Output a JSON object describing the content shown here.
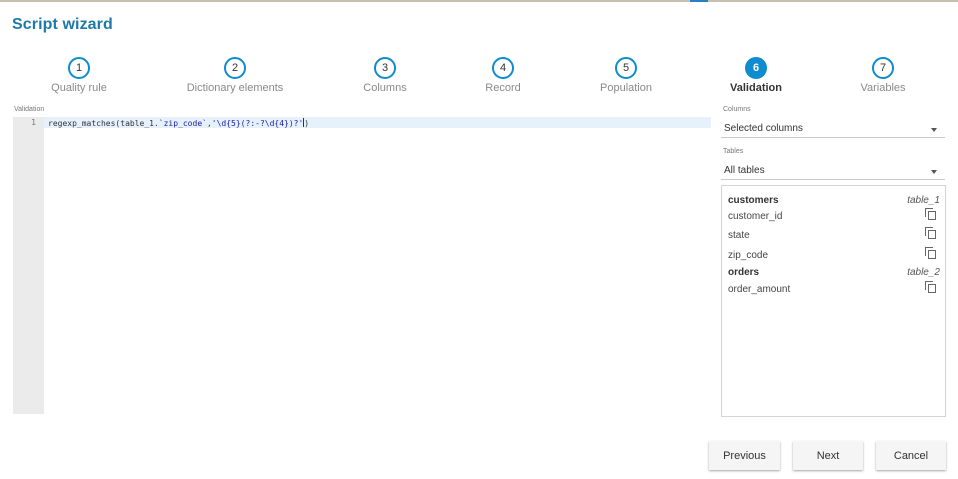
{
  "dialog": {
    "title": "Script wizard"
  },
  "steps": [
    {
      "number": "1",
      "label": "Quality rule"
    },
    {
      "number": "2",
      "label": "Dictionary elements"
    },
    {
      "number": "3",
      "label": "Columns"
    },
    {
      "number": "4",
      "label": "Record"
    },
    {
      "number": "5",
      "label": "Population"
    },
    {
      "number": "6",
      "label": "Validation",
      "active": true
    },
    {
      "number": "7",
      "label": "Variables"
    }
  ],
  "editor": {
    "caption": "Validation",
    "lines": [
      {
        "number": "1",
        "prefix": "regexp_matches(table_1.",
        "str1": "`zip_code`",
        "sep": ",",
        "str2": "'\\d{5}(?:-?\\d{4})?'",
        "suffix": ")"
      }
    ]
  },
  "columns_select": {
    "caption": "Columns",
    "value": "Selected columns"
  },
  "tables_select": {
    "caption": "Tables",
    "value": "All tables"
  },
  "tables": [
    {
      "name": "customers",
      "alias": "table_1",
      "columns": [
        "customer_id",
        "state",
        "zip_code"
      ]
    },
    {
      "name": "orders",
      "alias": "table_2",
      "columns": [
        "order_amount"
      ]
    }
  ],
  "buttons": {
    "previous": "Previous",
    "next": "Next",
    "cancel": "Cancel"
  },
  "colors": {
    "accent": "#0e8ccf",
    "title": "#1b7aa8"
  }
}
